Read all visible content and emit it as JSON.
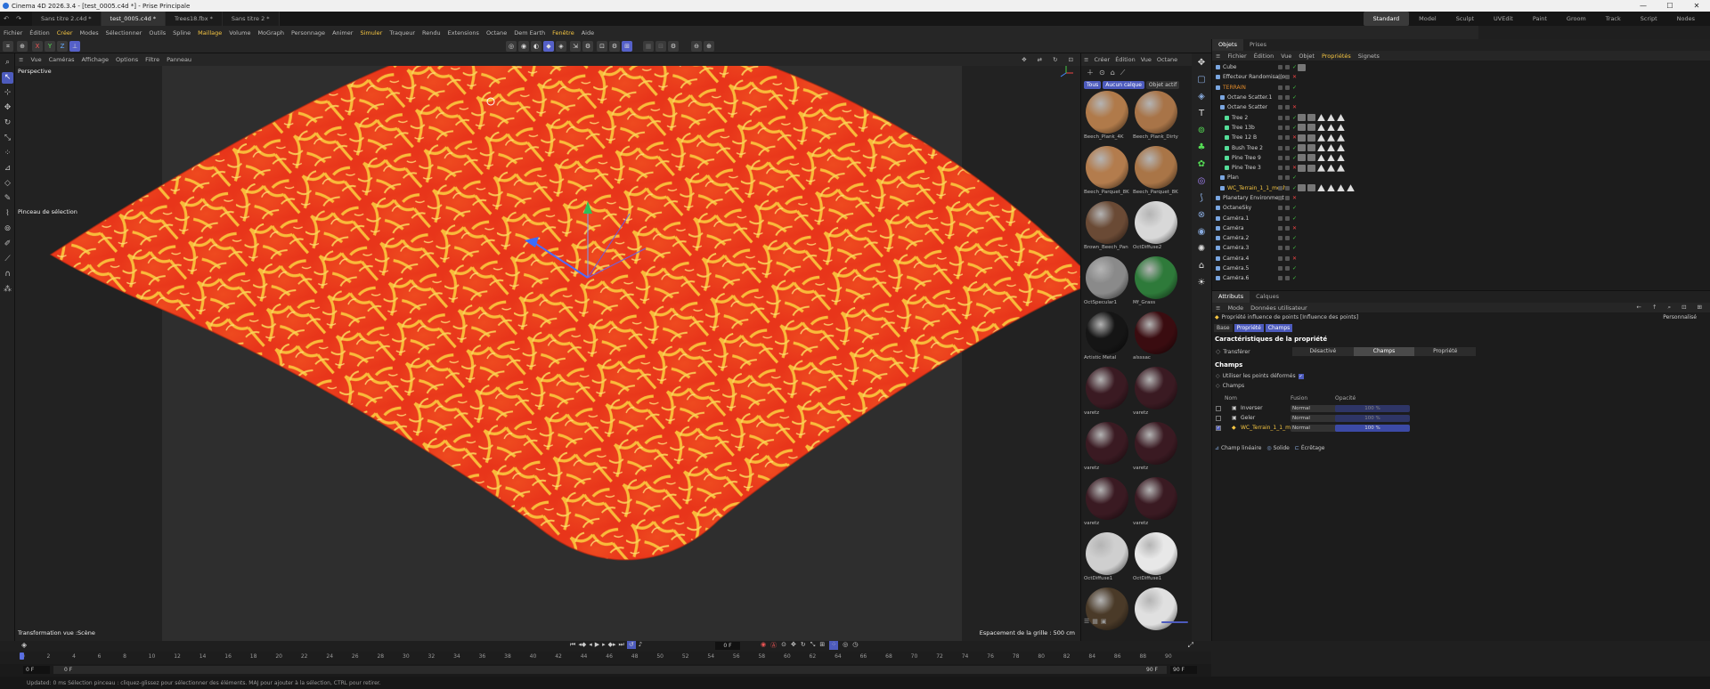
{
  "window": {
    "title": "Cinema 4D 2026.3.4 - [test_0005.c4d *] - Prise Principale"
  },
  "doc_tabs": [
    "Sans titre 2.c4d *",
    "test_0005.c4d *",
    "Trees18.fbx *",
    "Sans titre 2 *"
  ],
  "active_doc_tab": 1,
  "layouts": [
    "Standard",
    "Model",
    "Sculpt",
    "UVEdit",
    "Paint",
    "Groom",
    "Track",
    "Script",
    "Nodes"
  ],
  "menu": [
    "Fichier",
    "Édition",
    "Créer",
    "Modes",
    "Sélectionner",
    "Outils",
    "Spline",
    "Maillage",
    "Volume",
    "MoGraph",
    "Personnage",
    "Animer",
    "Simuler",
    "Traqueur",
    "Rendu",
    "Extensions",
    "Octane",
    "Dem Earth",
    "Fenêtre",
    "Aide"
  ],
  "menu_highlight": [
    "Créer",
    "Maillage",
    "Simuler",
    "Fenêtre"
  ],
  "axis_buttons": [
    "X",
    "Y",
    "Z"
  ],
  "viewport": {
    "menu": [
      "Vue",
      "Caméras",
      "Affichage",
      "Options",
      "Filtre",
      "Panneau"
    ],
    "camera_label": "Perspective",
    "tool_label": "Pinceau de sélection",
    "status_left": "Transformation vue :Scène",
    "status_right": "Espacement de la grille : 500 cm"
  },
  "materials": {
    "menu": [
      "Créer",
      "Édition",
      "Vue",
      "Octane"
    ],
    "filters": [
      "Tous",
      "Aucun calque",
      "Objet actif"
    ],
    "items": [
      {
        "name": "Beech_Plank_4K",
        "color": "#b07a4a"
      },
      {
        "name": "Beech_Plank_Dirty",
        "color": "#a87448"
      },
      {
        "name": "Beech_Parquet_8K",
        "color": "#b37c4d"
      },
      {
        "name": "Beech_Parquet_8K",
        "color": "#a97547"
      },
      {
        "name": "Brown_Beech_Pan",
        "color": "#6a4a35"
      },
      {
        "name": "OctDiffuse2",
        "color": "#d8d8d8"
      },
      {
        "name": "OctSpecular1",
        "color": "#8a8a8a"
      },
      {
        "name": "Mf_Grass",
        "color": "#2e7a3a"
      },
      {
        "name": "Artistic Metal",
        "color": "#151515"
      },
      {
        "name": "alsssac",
        "color": "#3a0c10"
      },
      {
        "name": "varetz",
        "color": "#3a1a22"
      },
      {
        "name": "varetz",
        "color": "#3a1a22"
      },
      {
        "name": "varetz",
        "color": "#3a1a22"
      },
      {
        "name": "varetz",
        "color": "#3a1a22"
      },
      {
        "name": "varetz",
        "color": "#3a1a22"
      },
      {
        "name": "varetz",
        "color": "#3a1a22"
      },
      {
        "name": "OctDiffuse1",
        "color": "#cfcfcf"
      },
      {
        "name": "OctDiffuse1",
        "color": "#e8e8e8"
      },
      {
        "name": "",
        "color": "#4a3a28"
      },
      {
        "name": "",
        "color": "#e0e0e0"
      }
    ]
  },
  "objects": {
    "tabs": [
      "Objets",
      "Prises"
    ],
    "menu": [
      "Fichier",
      "Édition",
      "Vue",
      "Objet",
      "Propriétés",
      "Signets"
    ],
    "items": [
      {
        "name": "Cube",
        "indent": 0,
        "color": "#cfcfcf"
      },
      {
        "name": "Effecteur Randomisation",
        "indent": 0,
        "color": "#cfcfcf"
      },
      {
        "name": "TERRAIN",
        "indent": 0,
        "color": "#e08a2a"
      },
      {
        "name": "Octane Scatter.1",
        "indent": 1,
        "color": "#cfcfcf"
      },
      {
        "name": "Octane Scatter",
        "indent": 1,
        "color": "#cfcfcf"
      },
      {
        "name": "Tree 2",
        "indent": 2,
        "color": "#cfcfcf"
      },
      {
        "name": "Tree 13b",
        "indent": 2,
        "color": "#cfcfcf"
      },
      {
        "name": "Tree 12 B",
        "indent": 2,
        "color": "#cfcfcf"
      },
      {
        "name": "Bush Tree 2",
        "indent": 2,
        "color": "#cfcfcf"
      },
      {
        "name": "Pine Tree 9",
        "indent": 2,
        "color": "#cfcfcf"
      },
      {
        "name": "Pine Tree 3",
        "indent": 2,
        "color": "#cfcfcf"
      },
      {
        "name": "Plan",
        "indent": 1,
        "color": "#cfcfcf"
      },
      {
        "name": "WC_Terrain_1_1_mesh",
        "indent": 1,
        "color": "#f5c542"
      },
      {
        "name": "Planetary Environment",
        "indent": 0,
        "color": "#cfcfcf"
      },
      {
        "name": "OctaneSky",
        "indent": 0,
        "color": "#cfcfcf"
      },
      {
        "name": "Caméra.1",
        "indent": 0,
        "color": "#cfcfcf"
      },
      {
        "name": "Caméra",
        "indent": 0,
        "color": "#cfcfcf"
      },
      {
        "name": "Caméra.2",
        "indent": 0,
        "color": "#cfcfcf"
      },
      {
        "name": "Caméra.3",
        "indent": 0,
        "color": "#cfcfcf"
      },
      {
        "name": "Caméra.4",
        "indent": 0,
        "color": "#cfcfcf"
      },
      {
        "name": "Caméra.5",
        "indent": 0,
        "color": "#cfcfcf"
      },
      {
        "name": "Caméra.6",
        "indent": 0,
        "color": "#cfcfcf"
      }
    ]
  },
  "attributes": {
    "tabs": [
      "Attributs",
      "Calques"
    ],
    "menu": [
      "Mode",
      "Données utilisateur"
    ],
    "object_line": "Propriété influence de points [Influence des points]",
    "preset": "Personnalisé",
    "subtabs": [
      "Base",
      "Propriété",
      "Champs"
    ],
    "section_title": "Caractéristiques de la propriété",
    "transferer_label": "Transférer",
    "segments": [
      "Désactivé",
      "Champs",
      "Propriété"
    ],
    "active_segment": 1,
    "champs_title": "Champs",
    "use_deformed": "Utiliser les points déformés",
    "champs_sub": "Champs",
    "table_headers": [
      "Nom",
      "Fusion",
      "Opacité"
    ],
    "rows": [
      {
        "name": "Inverser",
        "fusion": "Normal",
        "opacity": "100 %",
        "checked": false,
        "color": "#cfcfcf"
      },
      {
        "name": "Geler",
        "fusion": "Normal",
        "opacity": "100 %",
        "checked": false,
        "color": "#cfcfcf"
      },
      {
        "name": "WC_Terrain_1_1_mesh",
        "fusion": "Normal",
        "opacity": "100 %",
        "checked": true,
        "color": "#f5c542"
      }
    ],
    "bottom_buttons": [
      "Champ linéaire",
      "Solide",
      "Écrêtage"
    ]
  },
  "timeline": {
    "frame": "0 F",
    "ticks": [
      "0",
      "2",
      "4",
      "6",
      "8",
      "10",
      "12",
      "14",
      "16",
      "18",
      "20",
      "22",
      "24",
      "26",
      "28",
      "30",
      "32",
      "34",
      "36",
      "38",
      "40",
      "42",
      "44",
      "46",
      "48",
      "50",
      "52",
      "54",
      "56",
      "58",
      "60",
      "62",
      "64",
      "66",
      "68",
      "70",
      "72",
      "74",
      "76",
      "78",
      "80",
      "82",
      "84",
      "86",
      "88",
      "90"
    ],
    "start": "0 F",
    "start2": "0 F",
    "end": "90 F",
    "end2": "90 F"
  },
  "status": "Updated: 0 ms    Sélection pinceau : cliquez-glissez pour sélectionner des éléments. MAJ pour ajouter à la sélection, CTRL pour retirer.",
  "colors": {
    "accent": "#4d5bbd",
    "terrain_base": "#e8351a",
    "terrain_high": "#f9c23c",
    "highlight_text": "#f5c542"
  }
}
